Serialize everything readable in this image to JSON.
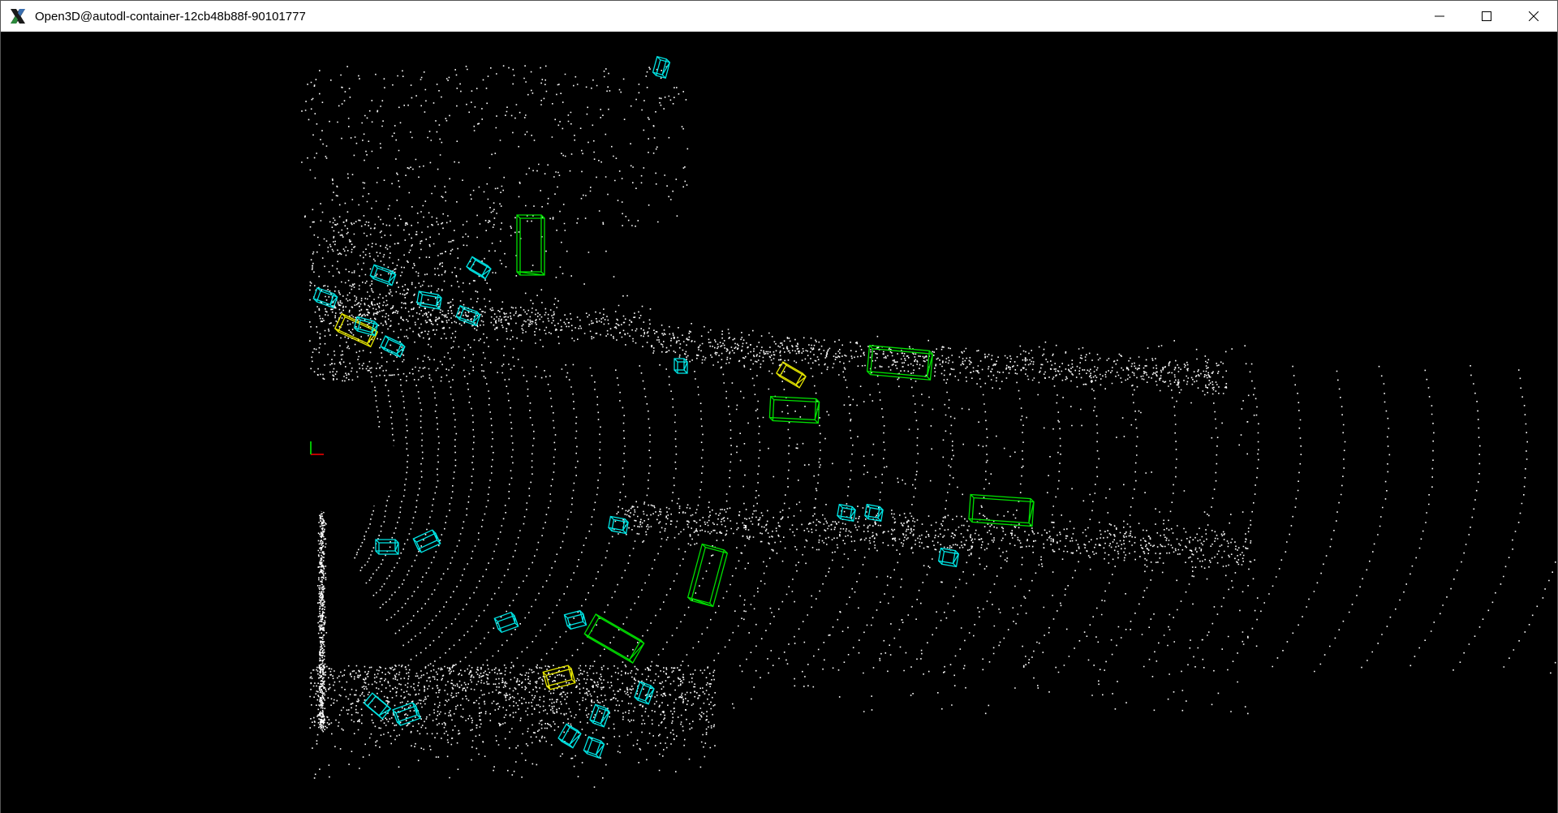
{
  "window": {
    "title": "Open3D@autodl-container-12cb48b88f-90101777",
    "app_icon": "x-logo-icon",
    "controls": {
      "minimize": "minimize-icon",
      "maximize": "maximize-icon",
      "close": "close-icon"
    }
  },
  "viewer": {
    "background": "#000000",
    "point_color": "#ffffff",
    "box_colors": {
      "car": "#00e000",
      "pedestrian": "#00e5e5",
      "cyclist": "#e6e600"
    },
    "axis_colors": {
      "x": "#ff0000",
      "y": "#00ff00"
    }
  }
}
